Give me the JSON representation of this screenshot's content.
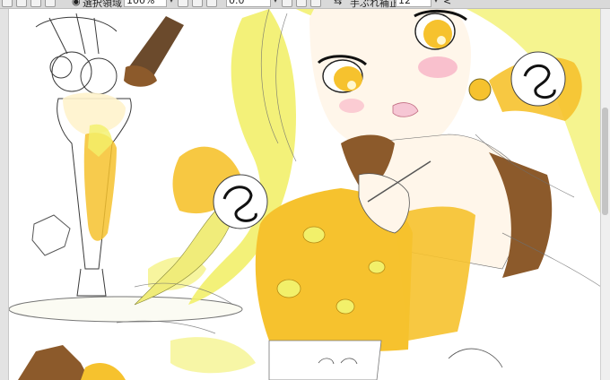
{
  "toolbar": {
    "selection_label": "選択領域",
    "zoom_value": "100%",
    "rotation_value": "0.0°",
    "stabilizer_label": "手ぶれ補正",
    "stabilizer_value": "12",
    "collapse_glyph": "<"
  },
  "colors": {
    "toolbar_bg": "#d9d9d9",
    "hair_yellow": "#f2f06a",
    "paint_yellow": "#f6c22e",
    "chocolate_brown": "#8c5a2b",
    "skin": "#fff6ea",
    "blush": "#f7a9c0",
    "sketch_line": "#3a3a3a"
  }
}
